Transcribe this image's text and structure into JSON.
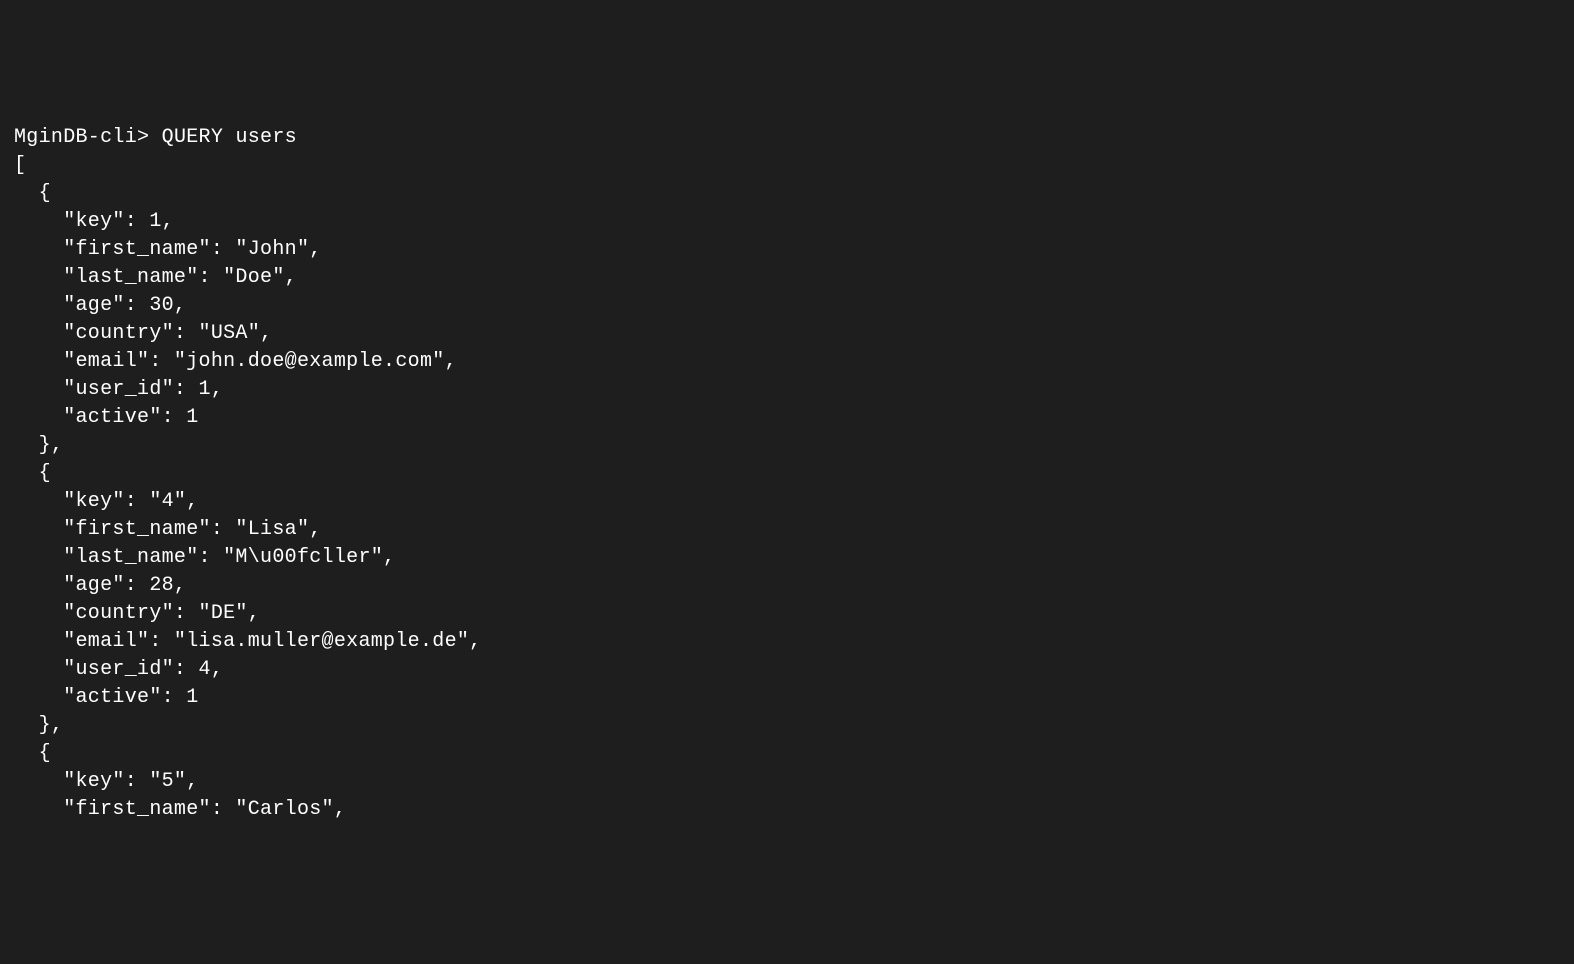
{
  "terminal": {
    "prompt": "MginDB-cli>",
    "command": "QUERY users",
    "output_lines": [
      "[",
      "  {",
      "    \"key\": 1,",
      "    \"first_name\": \"John\",",
      "    \"last_name\": \"Doe\",",
      "    \"age\": 30,",
      "    \"country\": \"USA\",",
      "    \"email\": \"john.doe@example.com\",",
      "    \"user_id\": 1,",
      "    \"active\": 1",
      "  },",
      "  {",
      "    \"key\": \"4\",",
      "    \"first_name\": \"Lisa\",",
      "    \"last_name\": \"M\\u00fcller\",",
      "    \"age\": 28,",
      "    \"country\": \"DE\",",
      "    \"email\": \"lisa.muller@example.de\",",
      "    \"user_id\": 4,",
      "    \"active\": 1",
      "  },",
      "  {",
      "    \"key\": \"5\",",
      "    \"first_name\": \"Carlos\","
    ]
  }
}
